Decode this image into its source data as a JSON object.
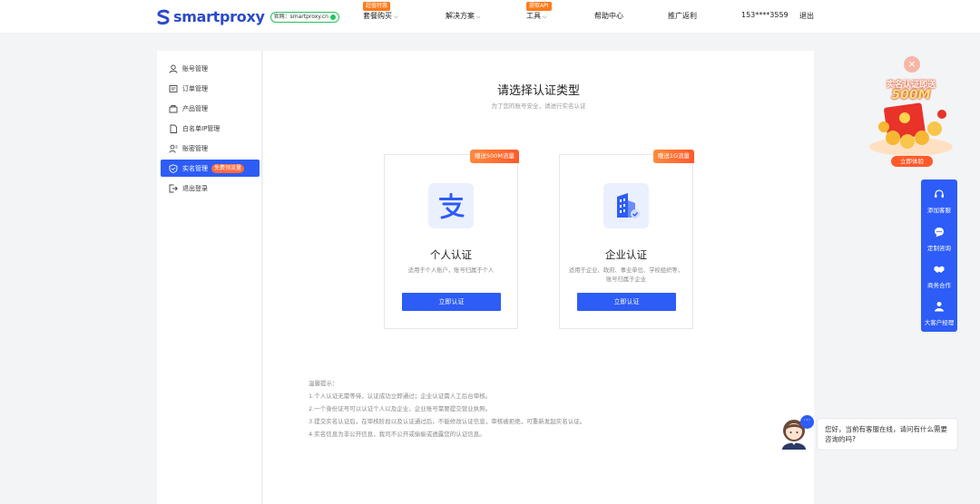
{
  "header": {
    "brand": "smartproxy",
    "site_badge": "官网：smartproxy.cn",
    "nav": [
      {
        "label": "套餐购买",
        "tag": "超值特惠",
        "has_chevron": true
      },
      {
        "label": "解决方案",
        "tag": "",
        "has_chevron": true
      },
      {
        "label": "工具",
        "tag": "提取API",
        "has_chevron": true
      },
      {
        "label": "帮助中心",
        "tag": "",
        "has_chevron": false
      },
      {
        "label": "推广返利",
        "tag": "",
        "has_chevron": false
      },
      {
        "label": "153****3559",
        "tag": "",
        "has_chevron": false
      },
      {
        "label": "退出",
        "tag": "",
        "has_chevron": false
      }
    ]
  },
  "sidebar": {
    "items": [
      {
        "label": "账号管理",
        "icon": "user-icon"
      },
      {
        "label": "订单管理",
        "icon": "order-icon"
      },
      {
        "label": "产品管理",
        "icon": "product-icon"
      },
      {
        "label": "白名单IP管理",
        "icon": "whitelist-icon"
      },
      {
        "label": "账密管理",
        "icon": "account-password-icon"
      },
      {
        "label": "实名管理",
        "icon": "shield-icon",
        "badge": "免费领流量",
        "active": true
      },
      {
        "label": "退出登录",
        "icon": "logout-icon"
      }
    ]
  },
  "main": {
    "title": "请选择认证类型",
    "subtitle": "为了您的账号安全，请进行实名认证",
    "cards": [
      {
        "ribbon": "赠送500M流量",
        "title": "个人认证",
        "desc": "适用于个人账户，账号归属于个人",
        "button": "立即认证",
        "icon": "alipay-icon"
      },
      {
        "ribbon": "赠送1G流量",
        "title": "企业认证",
        "desc": "适用于企业、政府、事业单位、学校组织等，账号归属于企业",
        "button": "立即认证",
        "icon": "building-icon"
      }
    ],
    "tips": [
      "温馨提示：",
      "1.个人认证无需等待，认证成功立即通过；企业认证需人工后台审核。",
      "2.一个身份证号可以认证个人以及企业，企业账号需要提交营业执照。",
      "3.提交实名认证后，在审核阶段以及认证通过后，不能修改认证信息，审核被拒绝，可重新发起实名认证。",
      "4.实名信息为非公开信息，我司不公开或偷偷或透露您的认证信息。"
    ]
  },
  "promo": {
    "headline": "实名认证即送",
    "amount": "500M",
    "button": "立即体验"
  },
  "service": {
    "items": [
      {
        "label": "添加客服",
        "icon": "headset-icon"
      },
      {
        "label": "定制咨询",
        "icon": "chat-icon"
      },
      {
        "label": "商务合作",
        "icon": "handshake-icon"
      },
      {
        "label": "大客户经理",
        "icon": "person-icon"
      }
    ]
  },
  "chat": {
    "message": "您好，当前有客服在线，请问有什么需要咨询的吗?"
  },
  "colors": {
    "primary": "#2d5cf6",
    "accent": "#ff6b3d",
    "brand": "#2b4acb"
  }
}
